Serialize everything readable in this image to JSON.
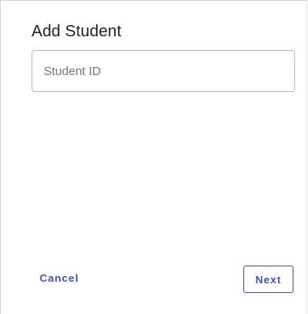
{
  "dialog": {
    "title": "Add Student",
    "student_id_field": {
      "value": "",
      "placeholder": "Student ID"
    },
    "actions": {
      "cancel_label": "Cancel",
      "next_label": "Next"
    }
  },
  "colors": {
    "accent": "#3f51b5",
    "field_border": "#b9b9b9",
    "title_text": "#1f1f1f"
  }
}
